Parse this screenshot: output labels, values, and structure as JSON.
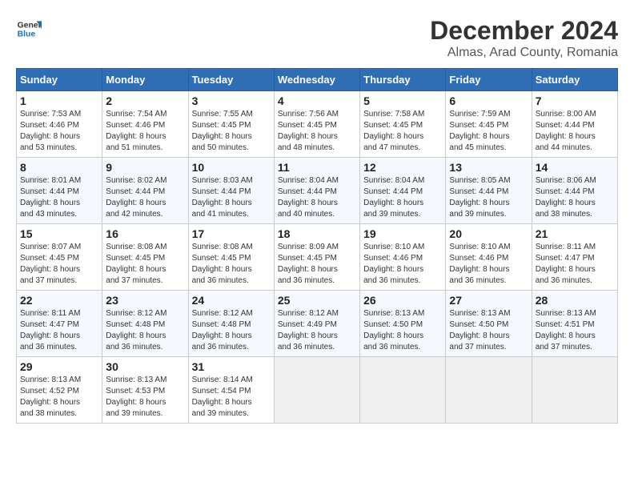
{
  "logo": {
    "text_general": "General",
    "text_blue": "Blue"
  },
  "title": {
    "month_year": "December 2024",
    "location": "Almas, Arad County, Romania"
  },
  "weekdays": [
    "Sunday",
    "Monday",
    "Tuesday",
    "Wednesday",
    "Thursday",
    "Friday",
    "Saturday"
  ],
  "weeks": [
    [
      {
        "day": "1",
        "sunrise": "7:53 AM",
        "sunset": "4:46 PM",
        "daylight": "8 hours and 53 minutes."
      },
      {
        "day": "2",
        "sunrise": "7:54 AM",
        "sunset": "4:46 PM",
        "daylight": "8 hours and 51 minutes."
      },
      {
        "day": "3",
        "sunrise": "7:55 AM",
        "sunset": "4:45 PM",
        "daylight": "8 hours and 50 minutes."
      },
      {
        "day": "4",
        "sunrise": "7:56 AM",
        "sunset": "4:45 PM",
        "daylight": "8 hours and 48 minutes."
      },
      {
        "day": "5",
        "sunrise": "7:58 AM",
        "sunset": "4:45 PM",
        "daylight": "8 hours and 47 minutes."
      },
      {
        "day": "6",
        "sunrise": "7:59 AM",
        "sunset": "4:45 PM",
        "daylight": "8 hours and 45 minutes."
      },
      {
        "day": "7",
        "sunrise": "8:00 AM",
        "sunset": "4:44 PM",
        "daylight": "8 hours and 44 minutes."
      }
    ],
    [
      {
        "day": "8",
        "sunrise": "8:01 AM",
        "sunset": "4:44 PM",
        "daylight": "8 hours and 43 minutes."
      },
      {
        "day": "9",
        "sunrise": "8:02 AM",
        "sunset": "4:44 PM",
        "daylight": "8 hours and 42 minutes."
      },
      {
        "day": "10",
        "sunrise": "8:03 AM",
        "sunset": "4:44 PM",
        "daylight": "8 hours and 41 minutes."
      },
      {
        "day": "11",
        "sunrise": "8:04 AM",
        "sunset": "4:44 PM",
        "daylight": "8 hours and 40 minutes."
      },
      {
        "day": "12",
        "sunrise": "8:04 AM",
        "sunset": "4:44 PM",
        "daylight": "8 hours and 39 minutes."
      },
      {
        "day": "13",
        "sunrise": "8:05 AM",
        "sunset": "4:44 PM",
        "daylight": "8 hours and 39 minutes."
      },
      {
        "day": "14",
        "sunrise": "8:06 AM",
        "sunset": "4:44 PM",
        "daylight": "8 hours and 38 minutes."
      }
    ],
    [
      {
        "day": "15",
        "sunrise": "8:07 AM",
        "sunset": "4:45 PM",
        "daylight": "8 hours and 37 minutes."
      },
      {
        "day": "16",
        "sunrise": "8:08 AM",
        "sunset": "4:45 PM",
        "daylight": "8 hours and 37 minutes."
      },
      {
        "day": "17",
        "sunrise": "8:08 AM",
        "sunset": "4:45 PM",
        "daylight": "8 hours and 36 minutes."
      },
      {
        "day": "18",
        "sunrise": "8:09 AM",
        "sunset": "4:45 PM",
        "daylight": "8 hours and 36 minutes."
      },
      {
        "day": "19",
        "sunrise": "8:10 AM",
        "sunset": "4:46 PM",
        "daylight": "8 hours and 36 minutes."
      },
      {
        "day": "20",
        "sunrise": "8:10 AM",
        "sunset": "4:46 PM",
        "daylight": "8 hours and 36 minutes."
      },
      {
        "day": "21",
        "sunrise": "8:11 AM",
        "sunset": "4:47 PM",
        "daylight": "8 hours and 36 minutes."
      }
    ],
    [
      {
        "day": "22",
        "sunrise": "8:11 AM",
        "sunset": "4:47 PM",
        "daylight": "8 hours and 36 minutes."
      },
      {
        "day": "23",
        "sunrise": "8:12 AM",
        "sunset": "4:48 PM",
        "daylight": "8 hours and 36 minutes."
      },
      {
        "day": "24",
        "sunrise": "8:12 AM",
        "sunset": "4:48 PM",
        "daylight": "8 hours and 36 minutes."
      },
      {
        "day": "25",
        "sunrise": "8:12 AM",
        "sunset": "4:49 PM",
        "daylight": "8 hours and 36 minutes."
      },
      {
        "day": "26",
        "sunrise": "8:13 AM",
        "sunset": "4:50 PM",
        "daylight": "8 hours and 36 minutes."
      },
      {
        "day": "27",
        "sunrise": "8:13 AM",
        "sunset": "4:50 PM",
        "daylight": "8 hours and 37 minutes."
      },
      {
        "day": "28",
        "sunrise": "8:13 AM",
        "sunset": "4:51 PM",
        "daylight": "8 hours and 37 minutes."
      }
    ],
    [
      {
        "day": "29",
        "sunrise": "8:13 AM",
        "sunset": "4:52 PM",
        "daylight": "8 hours and 38 minutes."
      },
      {
        "day": "30",
        "sunrise": "8:13 AM",
        "sunset": "4:53 PM",
        "daylight": "8 hours and 39 minutes."
      },
      {
        "day": "31",
        "sunrise": "8:14 AM",
        "sunset": "4:54 PM",
        "daylight": "8 hours and 39 minutes."
      },
      null,
      null,
      null,
      null
    ]
  ]
}
